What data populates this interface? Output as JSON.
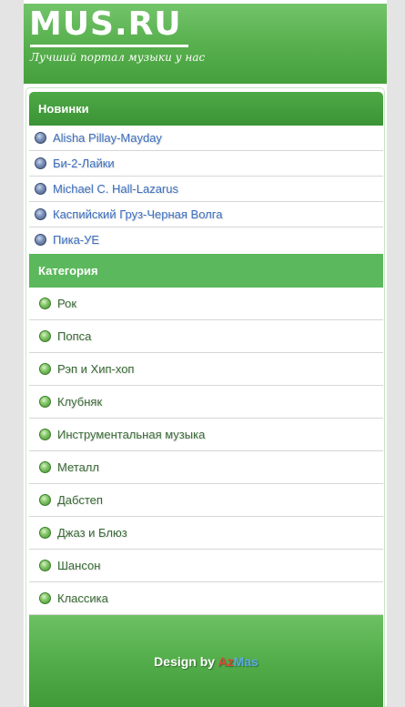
{
  "header": {
    "logo": "MUS.RU",
    "tagline": "Лучший портал музыки у нас"
  },
  "news": {
    "title": "Новинки",
    "items": [
      {
        "label": "Alisha Pillay-Mayday"
      },
      {
        "label": "Би-2-Лайки"
      },
      {
        "label": "Michael C. Hall-Lazarus"
      },
      {
        "label": "Каспийский Груз-Черная Волга"
      },
      {
        "label": "Пика-УЕ"
      }
    ]
  },
  "categories": {
    "title": "Категория",
    "items": [
      {
        "label": "Рок"
      },
      {
        "label": "Попса"
      },
      {
        "label": "Рэп и Хип-хоп"
      },
      {
        "label": "Клубняк"
      },
      {
        "label": "Инструментальная музыка"
      },
      {
        "label": "Металл"
      },
      {
        "label": "Дабстеп"
      },
      {
        "label": "Джаз и Блюз"
      },
      {
        "label": "Шансон"
      },
      {
        "label": "Классика"
      }
    ]
  },
  "footer": {
    "prefix": "Design by ",
    "brand_part1": "Az",
    "brand_part2": "Mas"
  },
  "colors": {
    "header_green": "#58b04e",
    "heading_dark_green": "#3b9335",
    "heading_light_green": "#5cb85c",
    "news_link": "#3b6fbf",
    "category_text": "#3a6b36",
    "brand_red": "#e2473a",
    "brand_blue": "#5aa9e6"
  }
}
